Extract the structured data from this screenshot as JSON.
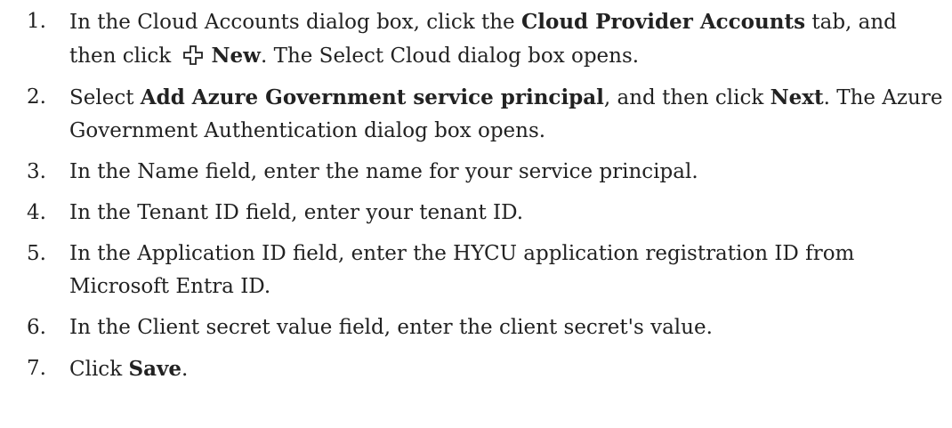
{
  "steps": [
    {
      "num": "1.",
      "parts": [
        "In the Cloud Accounts dialog box, click the ",
        "Cloud Provider Accounts",
        " tab, and then click ",
        "New",
        ". The Select Cloud dialog box opens."
      ],
      "icon": "plus-outline-icon"
    },
    {
      "num": "2.",
      "parts": [
        "Select ",
        "Add Azure Government service principal",
        ", and then click ",
        "Next",
        ". The Azure Government Authentication dialog box opens."
      ]
    },
    {
      "num": "3.",
      "text": "In the Name field, enter the name for your service principal."
    },
    {
      "num": "4.",
      "text": "In the Tenant ID field, enter your tenant ID."
    },
    {
      "num": "5.",
      "text": "In the Application ID field, enter the HYCU application registration ID from Microsoft Entra ID."
    },
    {
      "num": "6.",
      "text": "In the Client secret value field, enter the client secret's value."
    },
    {
      "num": "7.",
      "parts": [
        "Click ",
        "Save",
        "."
      ]
    }
  ]
}
